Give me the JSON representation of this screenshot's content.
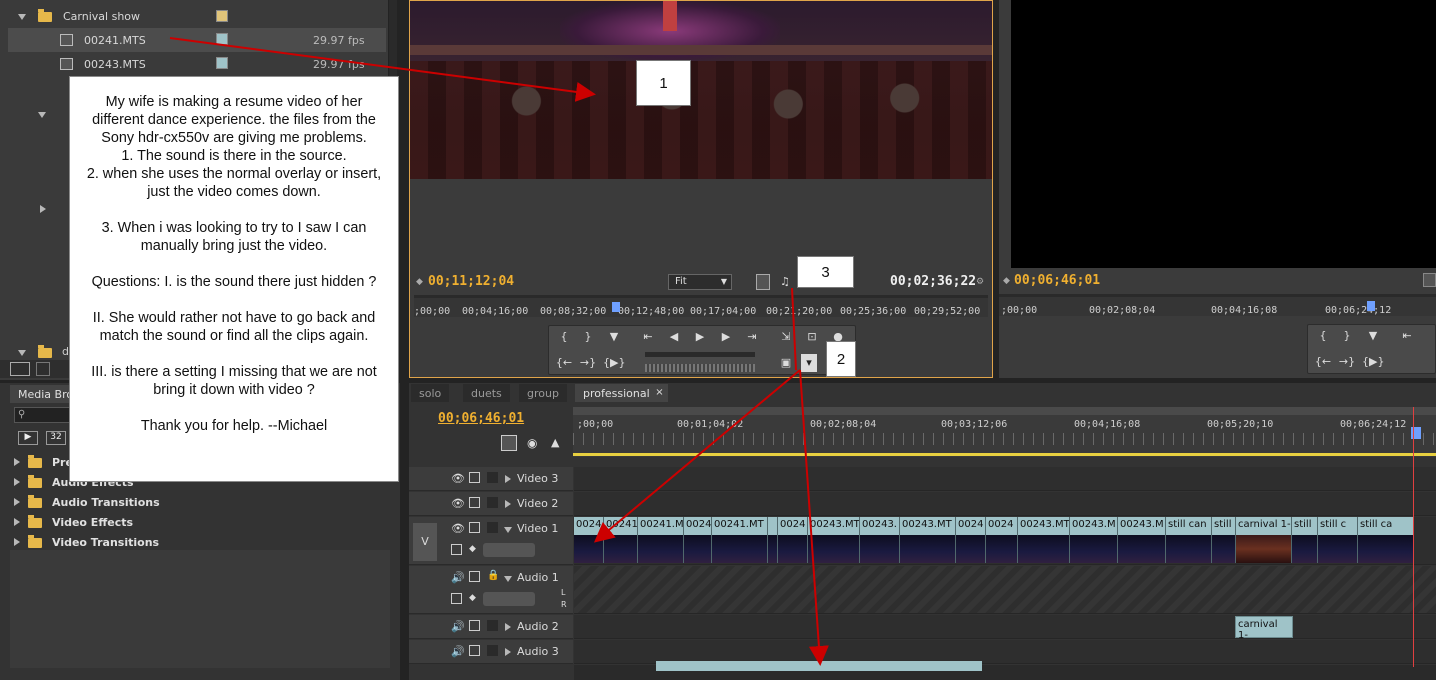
{
  "project": {
    "bin_name": "Carnival show",
    "bin2_name": "d",
    "clips": [
      {
        "name": "00241.MTS",
        "fps": "29.97 fps"
      },
      {
        "name": "00243.MTS",
        "fps": "29.97 fps"
      }
    ]
  },
  "effects": {
    "tab_label": "Media Bro",
    "search_placeholder": "",
    "badge_left": "32",
    "folders": [
      "Pre",
      "Audio Effects",
      "Audio Transitions",
      "Video Effects",
      "Video Transitions"
    ]
  },
  "source_monitor": {
    "current_time": "00;11;12;04",
    "duration": "00;02;36;22",
    "zoom": "Fit",
    "ruler_ticks": [
      ";00;00",
      "00;04;16;00",
      "00;08;32;00",
      "00;12;48;00",
      "00;17;04;00",
      "00;21;20;00",
      "00;25;36;00",
      "00;29;52;00"
    ]
  },
  "program_monitor": {
    "current_time": "00;06;46;01",
    "ruler_ticks": [
      ";00;00",
      "00;02;08;04",
      "00;04;16;08",
      "00;06;24;12"
    ]
  },
  "timeline": {
    "tabs": [
      "solo",
      "duets",
      "group",
      "professional"
    ],
    "active_tab": "professional",
    "current_time": "00;06;46;01",
    "ruler_ticks": [
      ";00;00",
      "00;01;04;02",
      "00;02;08;04",
      "00;03;12;06",
      "00;04;16;08",
      "00;05;20;10",
      "00;06;24;12"
    ],
    "tracks": {
      "video3": "Video 3",
      "video2": "Video 2",
      "video1": "Video 1",
      "audio1": "Audio 1",
      "audio2": "Audio 2",
      "audio3": "Audio 3",
      "v_label": "V",
      "lr_l": "L",
      "lr_r": "R"
    },
    "video1_clips": [
      "0024",
      "00241",
      "00241.M",
      "0024",
      "00241.MT",
      "",
      "0024",
      "00243.MT",
      "00243.",
      "00243.MT",
      "0024",
      "0024",
      "00243.MT",
      "00243.M",
      "00243.M",
      "still can",
      "still",
      "carnival 1-",
      "still",
      "still c",
      "still ca"
    ],
    "audio2_clip": "carnival 1-"
  },
  "note": {
    "text": "My wife is making a resume video of her\ndifferent dance experience. the files from the\nSony hdr-cx550v are giving me problems.\n1. The sound is there in the source.\n2. when she uses the normal overlay or insert,\njust the video comes down.\n\n3. When i was looking to try to I saw I can\nmanually bring just the video.\n\nQuestions: I. is the sound there just hidden ?\n\nII. She would rather not have to go back and\nmatch the sound or find all the clips again.\n\nIII. is there a setting I missing that we are not\nbring it down with video ?\n\nThank you for help.  --Michael"
  },
  "callouts": [
    "1",
    "2",
    "3"
  ],
  "colors": {
    "timecode": "#f0b030",
    "clip": "#9fc3c8",
    "annotation_arrow": "#cc0000",
    "playhead": "#e04040"
  }
}
